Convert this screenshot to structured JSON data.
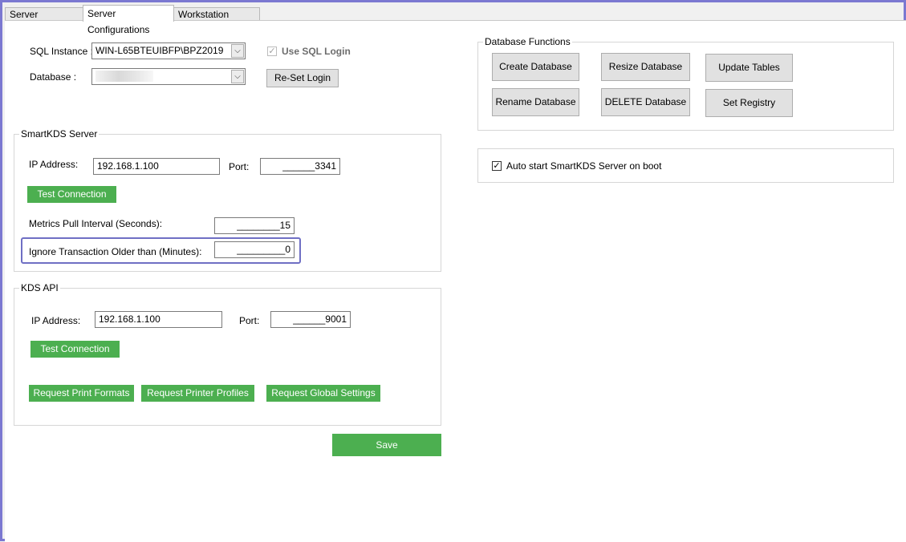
{
  "tabs": [
    {
      "label": "Server Operations"
    },
    {
      "label": "Server Configurations"
    },
    {
      "label": "Workstation Settings"
    }
  ],
  "sql": {
    "instance_label": "SQL Instance :",
    "instance_value": "WIN-L65BTEUIBFP\\BPZ2019",
    "database_label": "Database :",
    "use_sql_login_label": "Use SQL Login",
    "use_sql_login_checked": true,
    "reset_login_label": "Re-Set Login"
  },
  "smartkds": {
    "title": "SmartKDS Server",
    "ip_label": "IP Address:",
    "ip_value": "192.168.1.100",
    "port_label": "Port:",
    "port_value": "______3341",
    "test_label": "Test Connection",
    "metrics_label": "Metrics Pull Interval (Seconds):",
    "metrics_value": "________15",
    "ignore_label": "Ignore Transaction Older than (Minutes):",
    "ignore_value": "_________0"
  },
  "kds_api": {
    "title": "KDS API",
    "ip_label": "IP Address:",
    "ip_value": "192.168.1.100",
    "port_label": "Port:",
    "port_value": "______9001",
    "test_label": "Test Connection",
    "req_print_formats": "Request Print Formats",
    "req_printer_profiles": "Request Printer Profiles",
    "req_global_settings": "Request Global Settings"
  },
  "save_label": "Save",
  "db_functions": {
    "title": "Database Functions",
    "create": "Create Database",
    "resize": "Resize Database",
    "update": "Update Tables",
    "rename": "Rename Database",
    "delete": "DELETE Database",
    "registry": "Set Registry"
  },
  "autostart": {
    "label": "Auto start SmartKDS Server on boot",
    "checked": true
  },
  "colors": {
    "green": "#4caf50",
    "frame": "#7b78d1",
    "highlight": "#6f6fc4"
  }
}
